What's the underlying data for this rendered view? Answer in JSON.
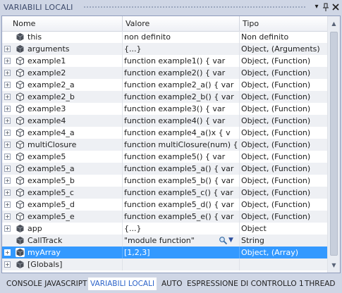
{
  "window": {
    "title": "VARIABILI LOCALI",
    "buttons": [
      "dropdown-arrow",
      "pin",
      "close"
    ]
  },
  "table": {
    "columns": {
      "name": "Nome",
      "value": "Valore",
      "type": "Tipo"
    },
    "rows": [
      {
        "name": "this",
        "value": "non definito",
        "type": "Non definito",
        "expandable": false,
        "icon": "variable-icon"
      },
      {
        "name": "arguments",
        "value": "{...}",
        "type": "Object, (Arguments)",
        "expandable": true,
        "icon": "variable-icon"
      },
      {
        "name": "example1",
        "value": "function example1()  {    var",
        "type": "Object, (Function)",
        "expandable": true,
        "icon": "function-icon"
      },
      {
        "name": "example2",
        "value": "function example2()  {    var",
        "type": "Object, (Function)",
        "expandable": true,
        "icon": "function-icon"
      },
      {
        "name": "example2_a",
        "value": "function example2_a()  {    var",
        "type": "Object, (Function)",
        "expandable": true,
        "icon": "function-icon"
      },
      {
        "name": "example2_b",
        "value": "function example2_b()  {    var",
        "type": "Object, (Function)",
        "expandable": true,
        "icon": "function-icon"
      },
      {
        "name": "example3",
        "value": "function example3()  {    var",
        "type": "Object, (Function)",
        "expandable": true,
        "icon": "function-icon"
      },
      {
        "name": "example4",
        "value": "function example4()  {    var",
        "type": "Object, (Function)",
        "expandable": true,
        "icon": "function-icon"
      },
      {
        "name": "example4_a",
        "value": "function example4_a()x  {    v",
        "type": "Object, (Function)",
        "expandable": true,
        "icon": "function-icon"
      },
      {
        "name": "multiClosure",
        "value": "function multiClosure(num) {",
        "type": "Object, (Function)",
        "expandable": true,
        "icon": "function-icon"
      },
      {
        "name": "example5",
        "value": "function example5()  {    var",
        "type": "Object, (Function)",
        "expandable": true,
        "icon": "function-icon"
      },
      {
        "name": "example5_a",
        "value": "function example5_a()  {    var",
        "type": "Object, (Function)",
        "expandable": true,
        "icon": "function-icon"
      },
      {
        "name": "example5_b",
        "value": "function example5_b()  {    var",
        "type": "Object, (Function)",
        "expandable": true,
        "icon": "function-icon"
      },
      {
        "name": "example5_c",
        "value": "function example5_c()  {    var",
        "type": "Object, (Function)",
        "expandable": true,
        "icon": "function-icon"
      },
      {
        "name": "example5_d",
        "value": "function example5_d()  {    var",
        "type": "Object, (Function)",
        "expandable": true,
        "icon": "function-icon"
      },
      {
        "name": "example5_e",
        "value": "function example5_e()  {    var",
        "type": "Object, (Function)",
        "expandable": true,
        "icon": "function-icon"
      },
      {
        "name": "app",
        "value": "{...}",
        "type": "Object",
        "expandable": true,
        "icon": "variable-icon"
      },
      {
        "name": "CallTrack",
        "value": "\"module function\"",
        "type": "String",
        "expandable": false,
        "icon": "variable-icon",
        "has_visualizer": true
      },
      {
        "name": "myArray",
        "value": "[1,2,3]",
        "type": "Object, (Array)",
        "expandable": true,
        "icon": "variable-icon",
        "selected": true
      },
      {
        "name": "[Globals]",
        "value": "",
        "type": "",
        "expandable": true,
        "icon": "variable-icon"
      }
    ]
  },
  "tabs": [
    {
      "label": "CONSOLE JAVASCRIPT",
      "active": false
    },
    {
      "label": "VARIABILI LOCALI",
      "active": true
    },
    {
      "label": "AUTO",
      "active": false
    },
    {
      "label": "ESPRESSIONE DI CONTROLLO 1",
      "active": false
    },
    {
      "label": "THREAD",
      "active": false
    }
  ],
  "colors": {
    "frame": "#cfd6e5",
    "selection": "#3399ff",
    "active_tab_text": "#2c63c9",
    "alt_row": "#eef0f4"
  }
}
